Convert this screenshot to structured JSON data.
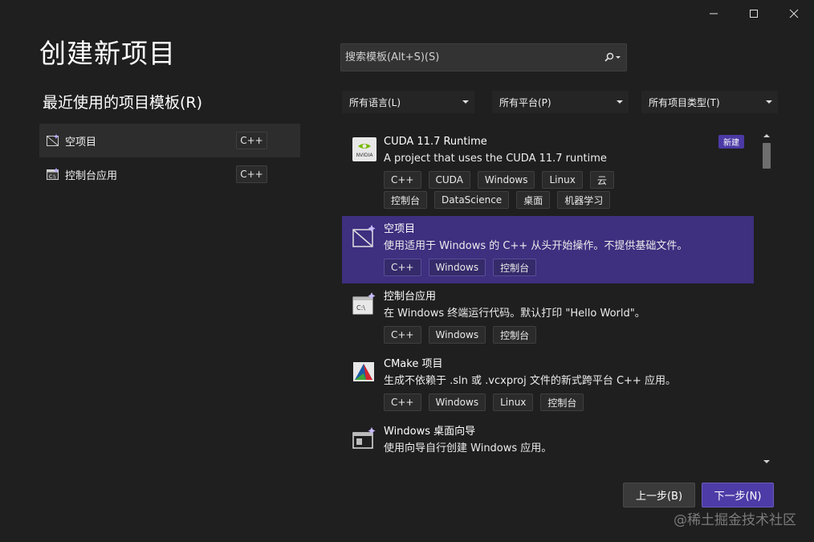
{
  "window": {
    "controls": [
      "minimize",
      "maximize",
      "close"
    ]
  },
  "page": {
    "title": "创建新项目",
    "recent_title": "最近使用的项目模板(R)"
  },
  "recent": [
    {
      "label": "空项目",
      "tag": "C++",
      "selected": true,
      "icon": "empty-project-icon"
    },
    {
      "label": "控制台应用",
      "tag": "C++",
      "selected": false,
      "icon": "console-app-icon"
    }
  ],
  "search": {
    "placeholder": "搜索模板(Alt+S)(S)",
    "value": ""
  },
  "filters": {
    "language": "所有语言(L)",
    "platform": "所有平台(P)",
    "project_type": "所有项目类型(T)"
  },
  "templates": [
    {
      "name": "CUDA 11.7 Runtime",
      "desc": "A project that uses the CUDA 11.7 runtime",
      "badge": "新建",
      "tags": [
        "C++",
        "CUDA",
        "Windows",
        "Linux",
        "云",
        "控制台",
        "DataScience",
        "桌面",
        "机器学习"
      ],
      "icon": "nvidia-icon"
    },
    {
      "name": "空项目",
      "desc": "使用适用于 Windows 的 C++ 从头开始操作。不提供基础文件。",
      "tags": [
        "C++",
        "Windows",
        "控制台"
      ],
      "icon": "empty-project-icon",
      "selected": true
    },
    {
      "name": "控制台应用",
      "desc": "在 Windows 终端运行代码。默认打印 \"Hello World\"。",
      "tags": [
        "C++",
        "Windows",
        "控制台"
      ],
      "icon": "console-app-icon"
    },
    {
      "name": "CMake 项目",
      "desc": "生成不依赖于 .sln 或 .vcxproj 文件的新式跨平台 C++ 应用。",
      "tags": [
        "C++",
        "Windows",
        "Linux",
        "控制台"
      ],
      "icon": "cmake-icon"
    },
    {
      "name": "Windows 桌面向导",
      "desc": "使用向导自行创建 Windows 应用。",
      "tags": [],
      "icon": "desktop-wizard-icon"
    }
  ],
  "buttons": {
    "back": "上一步(B)",
    "next": "下一步(N)"
  },
  "watermark": "@稀土掘金技术社区",
  "colors": {
    "background": "#1f1f1f",
    "accent": "#4d3ca7",
    "selection": "#3e2f7f"
  }
}
